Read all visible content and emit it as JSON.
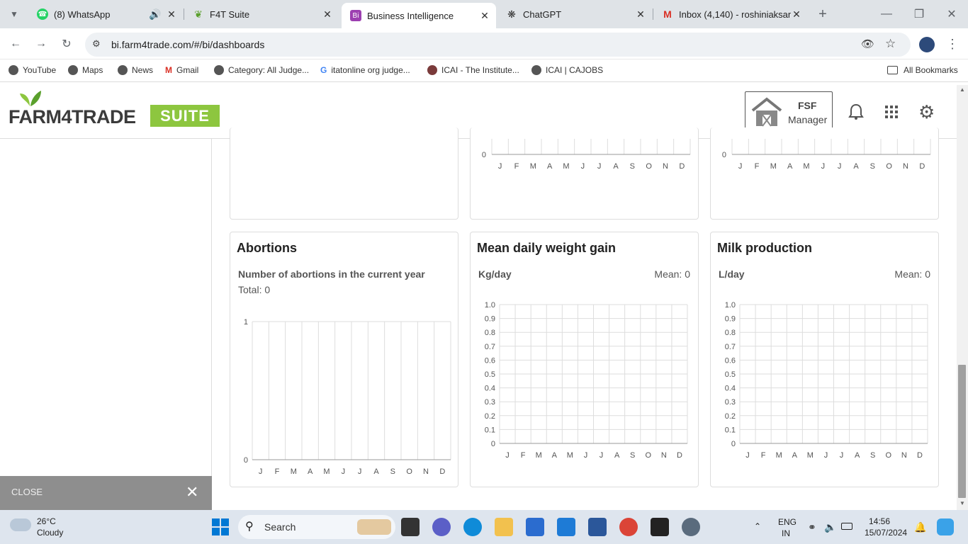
{
  "browser": {
    "tabs": [
      {
        "title": "(8) WhatsApp",
        "icon": "whatsapp-icon"
      },
      {
        "title": "F4T Suite",
        "icon": "leaf-icon"
      },
      {
        "title": "Business Intelligence",
        "icon": "bi-icon"
      },
      {
        "title": "ChatGPT",
        "icon": "chatgpt-icon"
      },
      {
        "title": "Inbox (4,140) - roshiniaksan",
        "icon": "gmail-icon"
      }
    ],
    "url": "bi.farm4trade.com/#/bi/dashboards",
    "bookmarks": [
      {
        "label": "YouTube"
      },
      {
        "label": "Maps"
      },
      {
        "label": "News"
      },
      {
        "label": "Gmail"
      },
      {
        "label": "Category: All Judge..."
      },
      {
        "label": "itatonline org judge..."
      },
      {
        "label": "ICAI - The Institute..."
      },
      {
        "label": "ICAI | CAJOBS"
      }
    ],
    "all_bookmarks": "All Bookmarks"
  },
  "app": {
    "logo_main": "FARM4TRADE",
    "logo_suite": "SUITE",
    "user_name": "FSF",
    "user_role": "Manager",
    "close_label": "CLOSE"
  },
  "months": [
    "J",
    "F",
    "M",
    "A",
    "M",
    "J",
    "J",
    "A",
    "S",
    "O",
    "N",
    "D"
  ],
  "cards": {
    "abortions": {
      "title": "Abortions",
      "subtitle": "Number of abortions in the current year",
      "total": "Total: 0"
    },
    "weight": {
      "title": "Mean daily weight gain",
      "unit": "Kg/day",
      "mean": "Mean: 0"
    },
    "milk": {
      "title": "Milk production",
      "unit": "L/day",
      "mean": "Mean: 0"
    }
  },
  "top_charts": {
    "zero_label": "0"
  },
  "chart_data": [
    {
      "type": "bar",
      "title": "Abortions",
      "categories": [
        "J",
        "F",
        "M",
        "A",
        "M",
        "J",
        "J",
        "A",
        "S",
        "O",
        "N",
        "D"
      ],
      "values": [
        0,
        0,
        0,
        0,
        0,
        0,
        0,
        0,
        0,
        0,
        0,
        0
      ],
      "ylim": [
        0,
        1
      ],
      "yticks": [
        "0",
        "1"
      ]
    },
    {
      "type": "line",
      "title": "Mean daily weight gain",
      "ylabel": "Kg/day",
      "categories": [
        "J",
        "F",
        "M",
        "A",
        "M",
        "J",
        "J",
        "A",
        "S",
        "O",
        "N",
        "D"
      ],
      "values": [
        0,
        0,
        0,
        0,
        0,
        0,
        0,
        0,
        0,
        0,
        0,
        0
      ],
      "ylim": [
        0,
        1
      ],
      "yticks": [
        "0",
        "0.1",
        "0.2",
        "0.3",
        "0.4",
        "0.5",
        "0.6",
        "0.7",
        "0.8",
        "0.9",
        "1.0"
      ]
    },
    {
      "type": "line",
      "title": "Milk production",
      "ylabel": "L/day",
      "categories": [
        "J",
        "F",
        "M",
        "A",
        "M",
        "J",
        "J",
        "A",
        "S",
        "O",
        "N",
        "D"
      ],
      "values": [
        0,
        0,
        0,
        0,
        0,
        0,
        0,
        0,
        0,
        0,
        0,
        0
      ],
      "ylim": [
        0,
        1
      ],
      "yticks": [
        "0",
        "0.1",
        "0.2",
        "0.3",
        "0.4",
        "0.5",
        "0.6",
        "0.7",
        "0.8",
        "0.9",
        "1.0"
      ]
    }
  ],
  "taskbar": {
    "weather_temp": "26°C",
    "weather_desc": "Cloudy",
    "search": "Search",
    "lang1": "ENG",
    "lang2": "IN",
    "time": "14:56",
    "date": "15/07/2024"
  },
  "colors": {
    "brand_green": "#8dc63f",
    "grid": "#dddddd"
  }
}
